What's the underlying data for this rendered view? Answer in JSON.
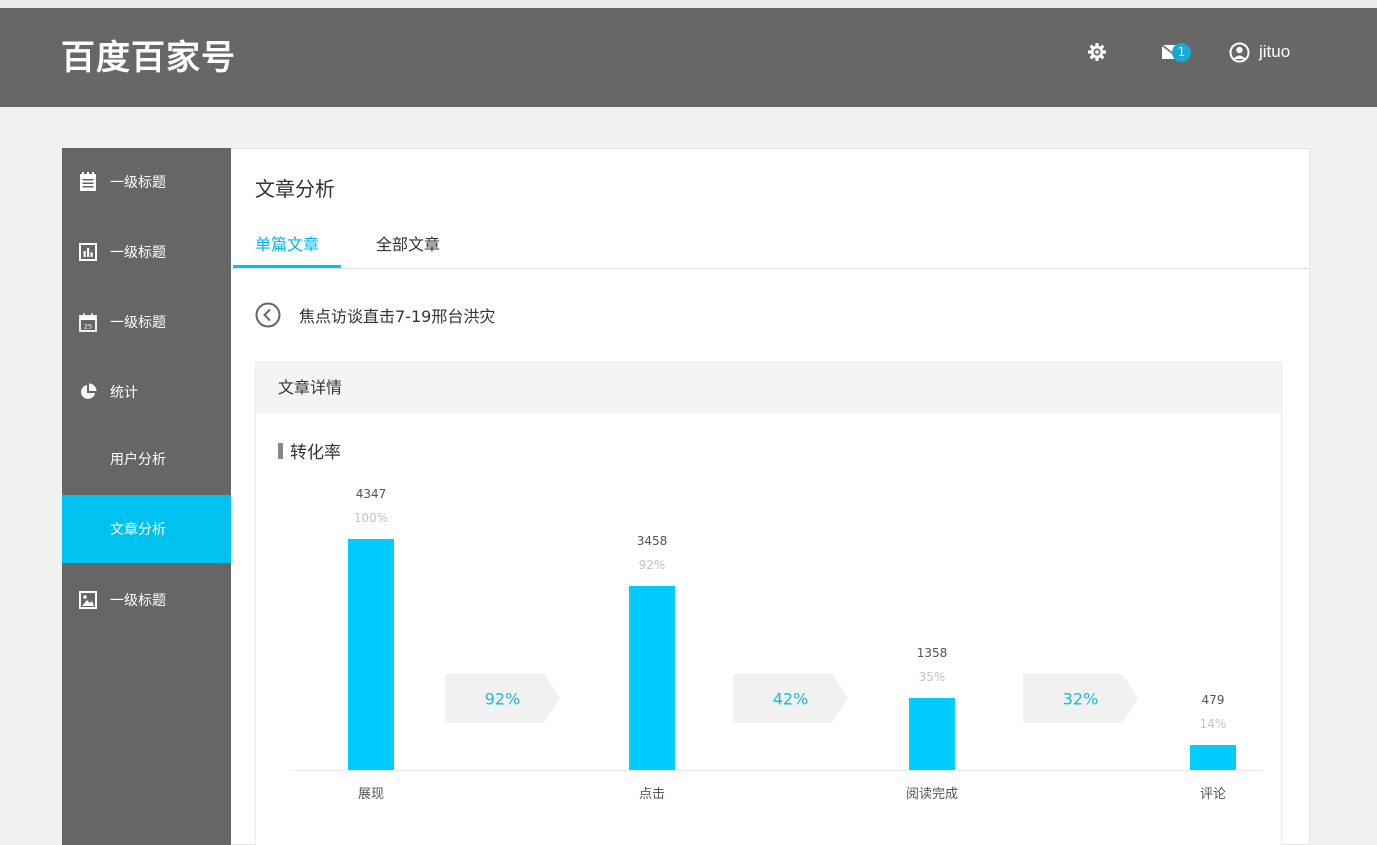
{
  "header": {
    "logo": "百度百家号",
    "gear_icon": "gear-icon",
    "mail_icon": "mail-icon",
    "mail_badge": "1",
    "user_icon": "user-circle-icon",
    "username": "jituo"
  },
  "sidebar": {
    "items": [
      {
        "label": "一级标题",
        "icon": "notepad-icon"
      },
      {
        "label": "一级标题",
        "icon": "bar-chart-icon"
      },
      {
        "label": "一级标题",
        "icon": "calendar-icon"
      },
      {
        "label": "统计",
        "icon": "pie-chart-icon"
      },
      {
        "label": "用户分析"
      },
      {
        "label": "文章分析",
        "active": true
      },
      {
        "label": "一级标题",
        "icon": "image-icon"
      }
    ],
    "active_color": "#00c1f0"
  },
  "main": {
    "title": "文章分析",
    "tabs": [
      {
        "label": "单篇文章",
        "active": true
      },
      {
        "label": "全部文章"
      }
    ],
    "article_title": "焦点访谈直击7-19邢台洪灾",
    "panel_title": "文章详情",
    "section_title": "转化率"
  },
  "chart_data": {
    "type": "bar",
    "categories": [
      "展现",
      "点击",
      "阅读完成",
      "评论"
    ],
    "values": [
      4347,
      3458,
      1358,
      479
    ],
    "percent_labels": [
      "100%",
      "92%",
      "35%",
      "14%"
    ],
    "conversion_rates": [
      "92%",
      "42%",
      "32%"
    ],
    "bar_color": "#00ccff",
    "grid": false,
    "legend": "none"
  }
}
